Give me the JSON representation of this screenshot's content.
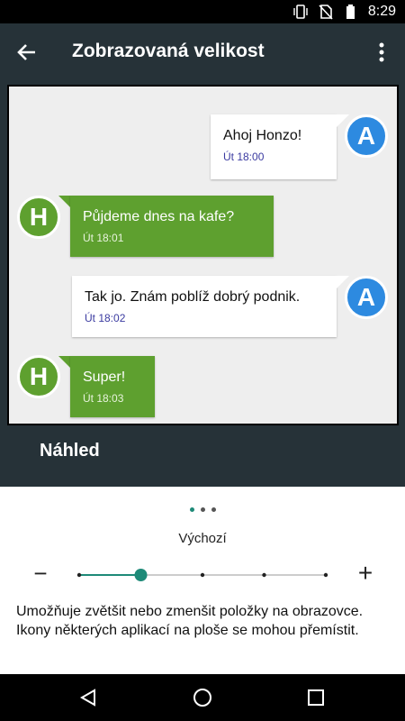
{
  "status_bar": {
    "time": "8:29",
    "icons": [
      "vibrate-icon",
      "no-sim-icon",
      "battery-icon"
    ]
  },
  "app_bar": {
    "title": "Zobrazovaná velikost",
    "back_icon": "back-arrow-icon",
    "menu_icon": "overflow-menu-icon"
  },
  "preview": {
    "messages": [
      {
        "side": "out",
        "avatar": "A",
        "text": "Ahoj Honzo!",
        "time": "Út 18:00"
      },
      {
        "side": "in",
        "avatar": "H",
        "text": "Půjdeme dnes na kafe?",
        "time": "Út 18:01"
      },
      {
        "side": "out",
        "avatar": "A",
        "text": "Tak jo. Znám poblíž dobrý podnik.",
        "time": "Út 18:02"
      },
      {
        "side": "in",
        "avatar": "H",
        "text": "Super!",
        "time": "Út 18:03"
      }
    ],
    "label": "Náhled"
  },
  "controls": {
    "page_dots": 3,
    "active_dot": 0,
    "size_label": "Výchozí",
    "minus_label": "−",
    "plus_label": "+",
    "slider_steps": 5,
    "slider_value_index": 1,
    "description": "Umožňuje zvětšit nebo zmenšit položky na obrazovce. Ikony některých aplikací na ploše se mohou přemístit."
  },
  "nav_bar": {
    "icons": [
      "back-triangle-icon",
      "home-circle-icon",
      "recents-square-icon"
    ]
  },
  "colors": {
    "accent": "#1e8a78",
    "bubble_in": "#5ea02f",
    "avatar_a": "#2d8ae0",
    "app_bg": "#263238"
  }
}
